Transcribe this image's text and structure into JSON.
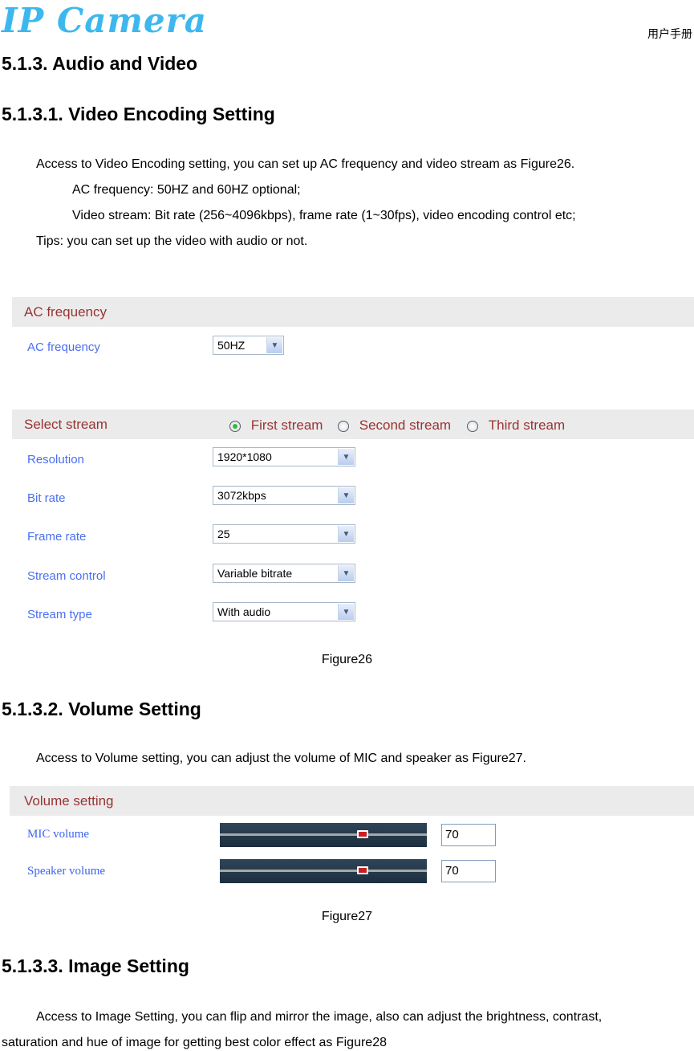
{
  "header": {
    "logo": "IP Camera",
    "manual_label": "用户手册"
  },
  "section": {
    "title": "5.1.3.  Audio and Video"
  },
  "video_encoding": {
    "title": "5.1.3.1. Video Encoding Setting",
    "intro": "Access to Video Encoding setting, you can set up AC frequency and video stream as Figure26.",
    "bullet_1": "AC frequency: 50HZ and 60HZ optional;",
    "bullet_2": "Video stream: Bit rate (256~4096kbps), frame rate (1~30fps), video encoding control etc;",
    "tips": "Tips: you can set up the video with audio or not.",
    "figure": {
      "ac_panel_title": "AC frequency",
      "ac_label": "AC frequency",
      "ac_value": "50HZ",
      "stream_panel_title": "Select stream",
      "stream_options": [
        {
          "label": "First stream",
          "selected": true
        },
        {
          "label": "Second stream",
          "selected": false
        },
        {
          "label": "Third stream",
          "selected": false
        }
      ],
      "fields": [
        {
          "label": "Resolution",
          "value": "1920*1080"
        },
        {
          "label": "Bit rate",
          "value": "3072kbps"
        },
        {
          "label": "Frame rate",
          "value": "25"
        },
        {
          "label": "Stream control",
          "value": "Variable bitrate"
        },
        {
          "label": "Stream type",
          "value": "With audio"
        }
      ],
      "caption": "Figure26"
    }
  },
  "volume": {
    "title": "5.1.3.2. Volume Setting",
    "intro": "Access to Volume setting, you can adjust the volume of MIC and speaker as Figure27.",
    "figure": {
      "panel_title": "Volume setting",
      "mic_label": "MIC volume",
      "mic_value": "70",
      "mic_level_percent": 70,
      "speaker_label": "Speaker volume",
      "speaker_value": "70",
      "speaker_level_percent": 70,
      "caption": "Figure27"
    }
  },
  "image": {
    "title": "5.1.3.3. Image Setting",
    "intro_line_1": "Access to Image Setting, you can flip and mirror the image, also can adjust the brightness, contrast,",
    "intro_line_2": "saturation and hue of image for getting best color effect as Figure28"
  }
}
